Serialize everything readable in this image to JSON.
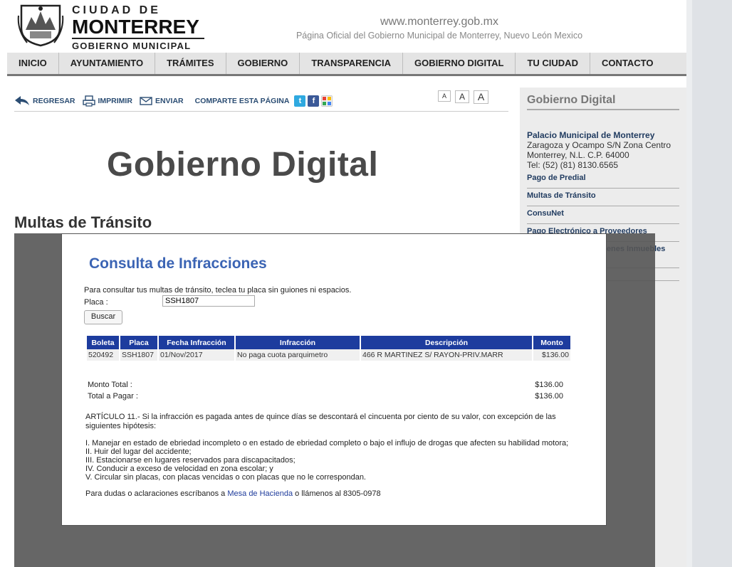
{
  "header": {
    "brand_line1": "CIUDAD DE",
    "brand_line2": "MONTERREY",
    "brand_line3": "GOBIERNO MUNICIPAL",
    "url": "www.monterrey.gob.mx",
    "subtitle": "Página Oficial del Gobierno Municipal de Monterrey, Nuevo León Mexico"
  },
  "nav": [
    "INICIO",
    "AYUNTAMIENTO",
    "TRÁMITES",
    "GOBIERNO",
    "TRANSPARENCIA",
    "GOBIERNO DIGITAL",
    "TU CIUDAD",
    "CONTACTO"
  ],
  "toolbar": {
    "regresar": "REGRESAR",
    "imprimir": "IMPRIMIR",
    "enviar": "ENVIAR",
    "comparte": "COMPARTE ESTA PÁGINA",
    "font_small": "A",
    "font_medium": "A",
    "font_large": "A"
  },
  "main": {
    "heading": "Gobierno Digital",
    "section_title": "Multas de Tránsito"
  },
  "sidebar": {
    "title": "Gobierno Digital",
    "palacio_name": "Palacio Municipal de Monterrey",
    "address1": "Zaragoza y Ocampo S/N Zona Centro",
    "address2": "Monterrey, N.L. C.P. 64000",
    "tel": "Tel: (52) (81) 8130.6565",
    "links": [
      "Pago de Predial",
      "Multas de Tránsito",
      "ConsuNet",
      "Pago Electrónico a Proveedores",
      "Padrón General de Bienes Inmuebles Municipales"
    ]
  },
  "modal": {
    "title": "Consulta de Infracciones",
    "intro": "Para consultar tus multas de tránsito, teclea tu placa sin guiones ni espacios.",
    "placa_label": "Placa :",
    "placa_value": "SSH1807",
    "buscar": "Buscar",
    "table": {
      "headers": [
        "Boleta",
        "Placa",
        "Fecha Infracción",
        "Infracción",
        "Descripción",
        "Monto"
      ],
      "row": [
        "520492",
        "SSH1807",
        "01/Nov/2017",
        "No paga cuota parquimetro",
        "466 R MARTINEZ S/ RAYON-PRIV.MARR",
        "$136.00"
      ]
    },
    "monto_total_label": "Monto Total :",
    "monto_total_value": "$136.00",
    "total_pagar_label": "Total a Pagar :",
    "total_pagar_value": "$136.00",
    "articulo": "ARTÍCULO 11.- Si la infracción es pagada antes de quince días se descontará el cincuenta por ciento de su valor, con excepción de las siguientes hipótesis:",
    "items": [
      "I. Manejar en estado de ebriedad incompleto o en estado de ebriedad completo o bajo el influjo de drogas que afecten su habilidad motora;",
      "II. Huir del lugar del accidente;",
      "III. Estacionarse en lugares reservados para discapacitados;",
      "IV. Conducir a exceso de velocidad en zona escolar; y",
      "V. Circular sin placas, con placas vencidas o con placas que no le correspondan."
    ],
    "dudas_pre": "Para dudas o aclaraciones escríbanos a",
    "dudas_link": "Mesa de Hacienda",
    "dudas_post": "o llámenos al 8305-0978"
  }
}
